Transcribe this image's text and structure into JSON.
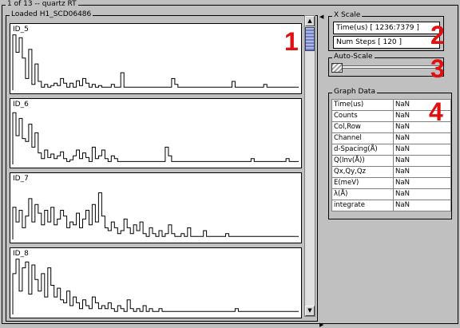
{
  "window": {
    "title": "1 of  13 -- quartz RT"
  },
  "plots_panel": {
    "title": "Loaded H1_SCD06486",
    "plots": [
      {
        "label": "ID_5",
        "chart_type": "step",
        "values": [
          0.95,
          0.65,
          0.9,
          0.55,
          0.2,
          0.7,
          0.1,
          0.45,
          0.15,
          0.05,
          0.1,
          0.05,
          0.08,
          0.12,
          0.08,
          0.2,
          0.12,
          0.05,
          0.12,
          0.05,
          0.16,
          0.08,
          0.2,
          0.12,
          0.05,
          0.1,
          0.05,
          0.08,
          0.05,
          0.05,
          0.05,
          0.1,
          0.05,
          0.05,
          0.3,
          0.05,
          0.05,
          0.05,
          0.05,
          0.05,
          0.05,
          0.05,
          0.05,
          0.05,
          0.05,
          0.05,
          0.05,
          0.05,
          0.05,
          0.05,
          0.2,
          0.1,
          0.05,
          0.05,
          0.05,
          0.05,
          0.05,
          0.05,
          0.05,
          0.05,
          0.05,
          0.05,
          0.05,
          0.05,
          0.05,
          0.05,
          0.05,
          0.05,
          0.05,
          0.15,
          0.05,
          0.05,
          0.05,
          0.05,
          0.05,
          0.05,
          0.05,
          0.05,
          0.05,
          0.1,
          0.05,
          0.05,
          0.05,
          0.05,
          0.05,
          0.05,
          0.05,
          0.05,
          0.05,
          0.05
        ]
      },
      {
        "label": "ID_6",
        "chart_type": "step",
        "values": [
          0.9,
          0.5,
          0.8,
          0.45,
          0.4,
          0.7,
          0.3,
          0.55,
          0.2,
          0.1,
          0.25,
          0.12,
          0.18,
          0.1,
          0.15,
          0.22,
          0.1,
          0.05,
          0.08,
          0.15,
          0.25,
          0.1,
          0.2,
          0.12,
          0.05,
          0.3,
          0.1,
          0.15,
          0.25,
          0.1,
          0.05,
          0.15,
          0.1,
          0.05,
          0.05,
          0.05,
          0.05,
          0.05,
          0.05,
          0.05,
          0.05,
          0.05,
          0.05,
          0.05,
          0.05,
          0.05,
          0.05,
          0.05,
          0.3,
          0.15,
          0.05,
          0.05,
          0.05,
          0.05,
          0.05,
          0.05,
          0.05,
          0.05,
          0.05,
          0.05,
          0.05,
          0.05,
          0.05,
          0.05,
          0.05,
          0.05,
          0.05,
          0.05,
          0.05,
          0.05,
          0.05,
          0.05,
          0.05,
          0.05,
          0.05,
          0.1,
          0.05,
          0.05,
          0.05,
          0.05,
          0.05,
          0.05,
          0.05,
          0.05,
          0.05,
          0.05,
          0.1,
          0.05,
          0.05,
          0.05
        ]
      },
      {
        "label": "ID_7",
        "chart_type": "step",
        "values": [
          0.55,
          0.3,
          0.5,
          0.2,
          0.4,
          0.7,
          0.3,
          0.6,
          0.45,
          0.25,
          0.5,
          0.3,
          0.55,
          0.25,
          0.35,
          0.5,
          0.4,
          0.2,
          0.3,
          0.25,
          0.45,
          0.2,
          0.35,
          0.5,
          0.25,
          0.6,
          0.3,
          0.8,
          0.4,
          0.2,
          0.15,
          0.3,
          0.2,
          0.1,
          0.15,
          0.35,
          0.2,
          0.1,
          0.25,
          0.15,
          0.3,
          0.1,
          0.05,
          0.2,
          0.1,
          0.05,
          0.15,
          0.05,
          0.1,
          0.25,
          0.1,
          0.05,
          0.05,
          0.1,
          0.05,
          0.2,
          0.05,
          0.05,
          0.05,
          0.05,
          0.15,
          0.05,
          0.05,
          0.05,
          0.05,
          0.05,
          0.05,
          0.1,
          0.05,
          0.05,
          0.05,
          0.05,
          0.05,
          0.05,
          0.05,
          0.05,
          0.05,
          0.05,
          0.05,
          0.05,
          0.05,
          0.05,
          0.05,
          0.05,
          0.05,
          0.05,
          0.05,
          0.05,
          0.05,
          0.05
        ]
      },
      {
        "label": "ID_8",
        "chart_type": "step",
        "values": [
          0.7,
          0.95,
          0.4,
          0.8,
          0.9,
          0.35,
          0.85,
          0.6,
          0.4,
          0.7,
          0.3,
          0.8,
          0.5,
          0.3,
          0.45,
          0.25,
          0.2,
          0.4,
          0.15,
          0.3,
          0.2,
          0.1,
          0.25,
          0.15,
          0.1,
          0.3,
          0.2,
          0.1,
          0.15,
          0.1,
          0.2,
          0.1,
          0.05,
          0.15,
          0.1,
          0.05,
          0.25,
          0.1,
          0.05,
          0.1,
          0.05,
          0.15,
          0.05,
          0.1,
          0.05,
          0.05,
          0.1,
          0.05,
          0.05,
          0.05,
          0.05,
          0.05,
          0.05,
          0.05,
          0.05,
          0.05,
          0.05,
          0.05,
          0.05,
          0.05,
          0.05,
          0.05,
          0.05,
          0.05,
          0.05,
          0.05,
          0.05,
          0.05,
          0.05,
          0.05,
          0.1,
          0.05,
          0.05,
          0.05,
          0.05,
          0.05,
          0.05,
          0.05,
          0.05,
          0.05,
          0.05,
          0.05,
          0.05,
          0.05,
          0.05,
          0.05,
          0.05,
          0.05,
          0.05,
          0.05
        ]
      }
    ]
  },
  "x_scale": {
    "title": "X Scale",
    "time_range": "Time(us) [ 1236:7379 ]",
    "num_steps": "Num Steps [ 120 ]"
  },
  "auto_scale": {
    "title": "Auto-Scale",
    "level": 0
  },
  "graph_data": {
    "title": "Graph Data",
    "rows": [
      {
        "key": "Time(us)",
        "value": "NaN"
      },
      {
        "key": "Counts",
        "value": "NaN"
      },
      {
        "key": "Col,Row",
        "value": "NaN"
      },
      {
        "key": "Channel",
        "value": "NaN"
      },
      {
        "key": "d-Spacing(Å)",
        "value": "NaN"
      },
      {
        "key": "Q(Inv(Å))",
        "value": "NaN"
      },
      {
        "key": "Qx,Qy,Qz",
        "value": "NaN"
      },
      {
        "key": "E(meV)",
        "value": "NaN"
      },
      {
        "key": "λ(Å)",
        "value": "NaN"
      },
      {
        "key": "integrate",
        "value": "NaN"
      }
    ]
  },
  "callouts": [
    "1",
    "2",
    "3",
    "4"
  ],
  "colors": {
    "callout": "#e01010",
    "background": "#c0c0c0",
    "scroll_thumb": "#7080c0"
  }
}
